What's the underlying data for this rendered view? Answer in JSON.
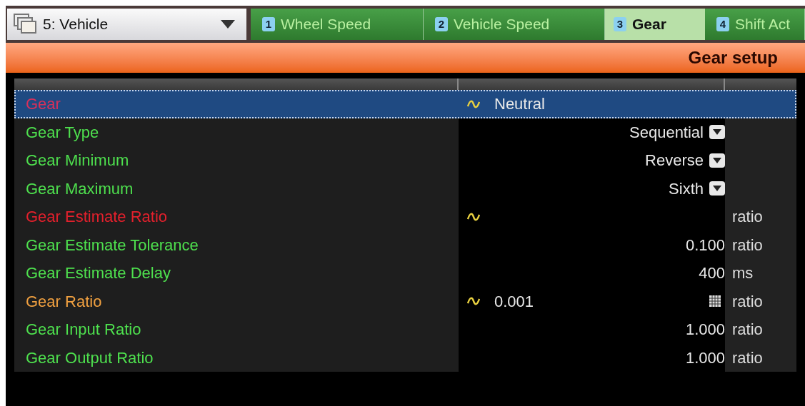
{
  "selector": {
    "value": "5: Vehicle"
  },
  "tabs": [
    {
      "number": "1",
      "label": "Wheel Speed",
      "selected": false
    },
    {
      "number": "2",
      "label": "Vehicle Speed",
      "selected": false
    },
    {
      "number": "3",
      "label": "Gear",
      "selected": true
    },
    {
      "number": "4",
      "label": "Shift Act",
      "selected": false
    }
  ],
  "panel": {
    "title": "Gear setup"
  },
  "rows": [
    {
      "label": "Gear",
      "color": "#d8305a",
      "selected": true,
      "live": true,
      "kind": "value",
      "value": "Neutral"
    },
    {
      "label": "Gear Type",
      "color": "#4ee04e",
      "selected": false,
      "live": false,
      "kind": "dropdown",
      "value": "Sequential"
    },
    {
      "label": "Gear Minimum",
      "color": "#4ee04e",
      "selected": false,
      "live": false,
      "kind": "dropdown",
      "value": "Reverse"
    },
    {
      "label": "Gear Maximum",
      "color": "#4ee04e",
      "selected": false,
      "live": false,
      "kind": "dropdown",
      "value": "Sixth"
    },
    {
      "label": "Gear Estimate Ratio",
      "color": "#e3202c",
      "selected": false,
      "live": true,
      "kind": "value",
      "unit": "ratio"
    },
    {
      "label": "Gear Estimate Tolerance",
      "color": "#4ee04e",
      "selected": false,
      "live": false,
      "kind": "value",
      "value": "0.100",
      "unit": "ratio"
    },
    {
      "label": "Gear Estimate Delay",
      "color": "#4ee04e",
      "selected": false,
      "live": false,
      "kind": "value",
      "value": "400",
      "unit": "ms"
    },
    {
      "label": "Gear Ratio",
      "color": "#f0a040",
      "selected": false,
      "live": true,
      "kind": "table",
      "value": "0.001",
      "unit": "ratio"
    },
    {
      "label": "Gear Input Ratio",
      "color": "#4ee04e",
      "selected": false,
      "live": false,
      "kind": "value",
      "value": "1.000",
      "unit": "ratio"
    },
    {
      "label": "Gear Output Ratio",
      "color": "#4ee04e",
      "selected": false,
      "live": false,
      "kind": "value",
      "value": "1.000",
      "unit": "ratio"
    }
  ]
}
